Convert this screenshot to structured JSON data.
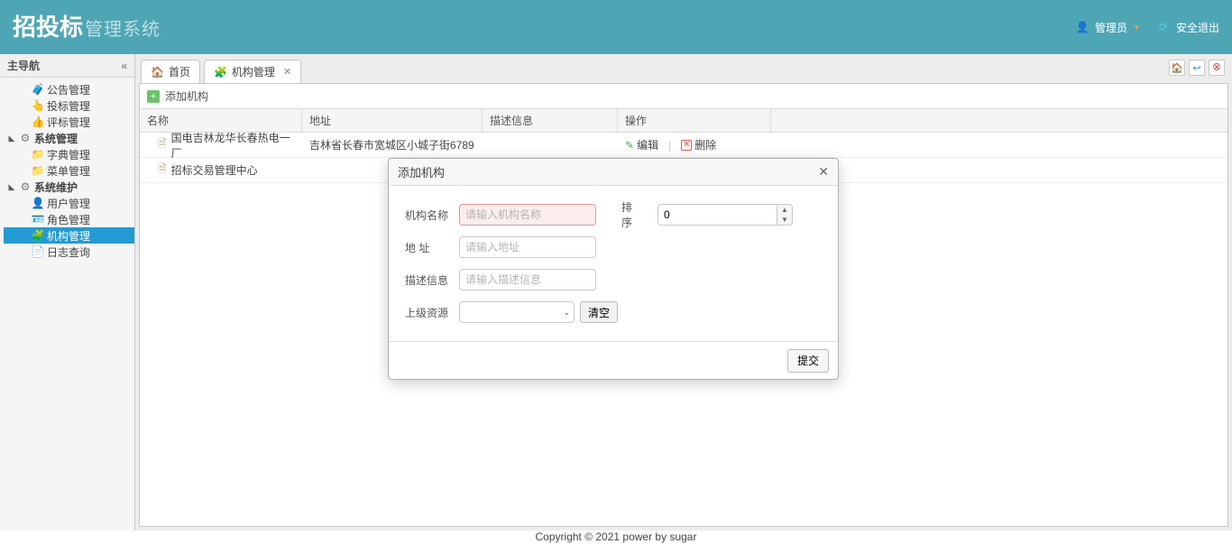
{
  "logo": {
    "big": "招投标",
    "small": "管理系统"
  },
  "top": {
    "user_label": "管理员",
    "logout_label": "安全退出"
  },
  "sidebar": {
    "title": "主导航",
    "nodes": {
      "announce": "公告管理",
      "bid": "投标管理",
      "review": "评标管理",
      "sys_mgmt": "系统管理",
      "dict": "字典管理",
      "menu": "菜单管理",
      "sys_maint": "系统维护",
      "user_mgmt": "用户管理",
      "role_mgmt": "角色管理",
      "org_mgmt": "机构管理",
      "log_query": "日志查询"
    }
  },
  "tabs": {
    "home": "首页",
    "org": "机构管理"
  },
  "toolbar": {
    "add_org": "添加机构"
  },
  "grid": {
    "headers": {
      "name": "名称",
      "addr": "地址",
      "desc": "描述信息",
      "op": "操作"
    },
    "op": {
      "edit": "编辑",
      "del": "删除"
    },
    "rows": [
      {
        "name": "国电吉林龙华长春热电一厂",
        "addr": "吉林省长春市宽城区小城子街6789",
        "desc": ""
      },
      {
        "name": "招标交易管理中心",
        "addr": "",
        "desc": ""
      }
    ]
  },
  "dialog": {
    "title": "添加机构",
    "labels": {
      "org_name": "机构名称",
      "order": "排 序",
      "addr": "地 址",
      "desc": "描述信息",
      "parent": "上级资源"
    },
    "placeholders": {
      "org_name": "请输入机构名称",
      "addr": "请输入地址",
      "desc": "请输入描述信息"
    },
    "values": {
      "order": "0",
      "org_name": "",
      "addr": "",
      "desc": "",
      "parent": ""
    },
    "buttons": {
      "clear": "清空",
      "submit": "提交"
    }
  },
  "footer": "Copyright © 2021 power by sugar",
  "icons": {
    "collapse": "«",
    "home_ic": "🏠",
    "org_ic": "🧩",
    "add": "+",
    "user": "👤",
    "refresh": "⟳"
  }
}
